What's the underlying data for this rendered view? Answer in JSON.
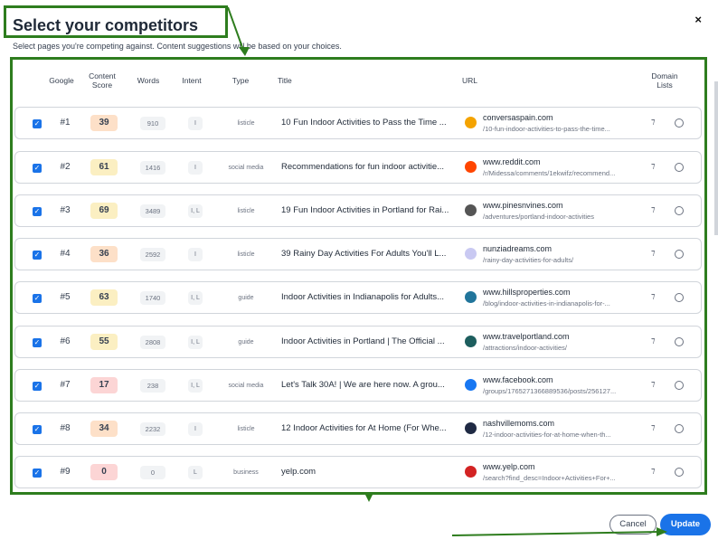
{
  "dialog": {
    "title": "Select your competitors",
    "subtitle": "Select pages you're competing against. Content suggestions will be based on your choices.",
    "close_label": "×",
    "cancel_label": "Cancel",
    "update_label": "Update"
  },
  "columns": {
    "google": "Google",
    "content_score": "Content Score",
    "words": "Words",
    "intent": "Intent",
    "type": "Type",
    "title": "Title",
    "url": "URL",
    "domain_lists": "Domain Lists"
  },
  "rows": [
    {
      "rank": "#1",
      "score": "39",
      "score_color": "#fde0c8",
      "words": "910",
      "intent": "I",
      "type": "listicle",
      "title": "10 Fun Indoor Activities to Pass the Time ...",
      "domain": "conversaspain.com",
      "path": "/10-fun-indoor-activities-to-pass-the-time...",
      "favicon_color": "#f4a300",
      "favicon_icon": "conversa-logo-icon"
    },
    {
      "rank": "#2",
      "score": "61",
      "score_color": "#fbefc2",
      "words": "1416",
      "intent": "I",
      "type": "social media",
      "title": "Recommendations for fun indoor activitie...",
      "domain": "www.reddit.com",
      "path": "/r/Midessa/comments/1ekwifz/recommend...",
      "favicon_color": "#ff4500",
      "favicon_icon": "reddit-icon"
    },
    {
      "rank": "#3",
      "score": "69",
      "score_color": "#fbefc2",
      "words": "3489",
      "intent": "I, L",
      "type": "listicle",
      "title": "19 Fun Indoor Activities in Portland for Rai...",
      "domain": "www.pinesnvines.com",
      "path": "/adventures/portland-indoor-activities",
      "favicon_color": "#555555",
      "favicon_icon": "pinesnvines-icon"
    },
    {
      "rank": "#4",
      "score": "36",
      "score_color": "#fde0c8",
      "words": "2592",
      "intent": "I",
      "type": "listicle",
      "title": "39 Rainy Day Activities For Adults You'll L...",
      "domain": "nunziadreams.com",
      "path": "/rainy-day-activities-for-adults/",
      "favicon_color": "#c9c9f2",
      "favicon_icon": "nunzia-icon"
    },
    {
      "rank": "#5",
      "score": "63",
      "score_color": "#fbefc2",
      "words": "1740",
      "intent": "I, L",
      "type": "guide",
      "title": "Indoor Activities in Indianapolis for Adults...",
      "domain": "www.hillsproperties.com",
      "path": "/blog/indoor-activities-in-indianapolis-for-...",
      "favicon_color": "#21759b",
      "favicon_icon": "wordpress-icon"
    },
    {
      "rank": "#6",
      "score": "55",
      "score_color": "#fbefc2",
      "words": "2808",
      "intent": "I, L",
      "type": "guide",
      "title": "Indoor Activities in Portland | The Official ...",
      "domain": "www.travelportland.com",
      "path": "/attractions/indoor-activities/",
      "favicon_color": "#1d5e5e",
      "favicon_icon": "travelportland-icon"
    },
    {
      "rank": "#7",
      "score": "17",
      "score_color": "#fcd5d5",
      "words": "238",
      "intent": "I, L",
      "type": "social media",
      "title": "Let's Talk 30A! | We are here now. A grou...",
      "domain": "www.facebook.com",
      "path": "/groups/1765271366889536/posts/256127...",
      "favicon_color": "#1877f2",
      "favicon_icon": "facebook-icon"
    },
    {
      "rank": "#8",
      "score": "34",
      "score_color": "#fde0c8",
      "words": "2232",
      "intent": "I",
      "type": "listicle",
      "title": "12 Indoor Activities for At Home (For Whe...",
      "domain": "nashvillemoms.com",
      "path": "/12-indoor-activities-for-at-home-when-th...",
      "favicon_color": "#1f2a44",
      "favicon_icon": "nashvillemoms-icon"
    },
    {
      "rank": "#9",
      "score": "0",
      "score_color": "#fcd5d5",
      "words": "0",
      "intent": "L",
      "type": "business",
      "title": "yelp.com",
      "domain": "www.yelp.com",
      "path": "/search?find_desc=Indoor+Activities+For+...",
      "favicon_color": "#d32323",
      "favicon_icon": "yelp-icon"
    }
  ]
}
